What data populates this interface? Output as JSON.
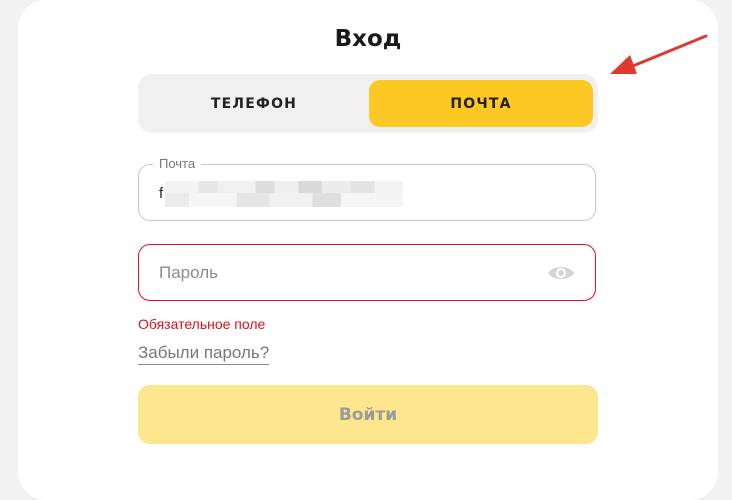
{
  "page": {
    "title": "Вход"
  },
  "method_toggle": {
    "phone_label": "ТЕЛЕФОН",
    "email_label": "ПОЧТА",
    "selected": "email"
  },
  "email_field": {
    "label": "Почта",
    "value_visible_prefix": "f"
  },
  "password_field": {
    "placeholder": "Пароль",
    "error": "Обязательное поле"
  },
  "forgot_password": {
    "label": "Забыли пароль?"
  },
  "submit": {
    "label": "Войти",
    "enabled": false
  },
  "annotation": {
    "icon": "red-arrow-icon"
  },
  "colors": {
    "accent": "#fdc823",
    "accent_disabled": "#fde68d",
    "error": "#d9121f",
    "annotation": "#e03a2f"
  }
}
